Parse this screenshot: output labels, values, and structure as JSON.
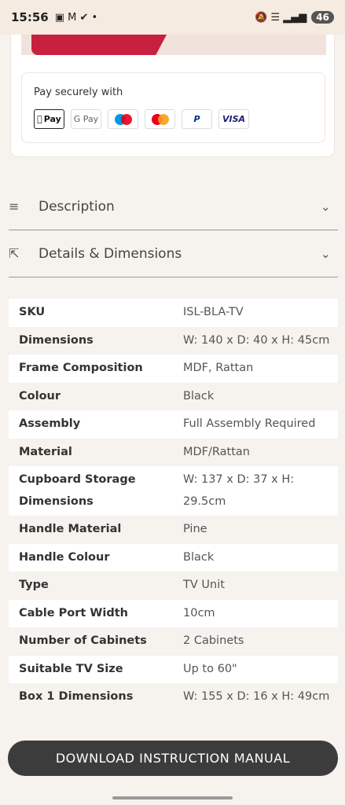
{
  "status": {
    "time": "15:56",
    "notif_icons": "▣ M ✔ •",
    "right_icons": "🔕 ☰ ▂▄▆",
    "battery": "46"
  },
  "payment": {
    "title": "Pay securely with",
    "methods": [
      "Pay",
      "G Pay",
      "maestro",
      "mastercard",
      "P",
      "VISA"
    ]
  },
  "accordion": {
    "description": "Description",
    "details": "Details & Dimensions"
  },
  "specs": [
    {
      "key": "SKU",
      "value": "ISL-BLA-TV"
    },
    {
      "key": "Dimensions",
      "value": "W: 140 x D: 40 x H: 45cm"
    },
    {
      "key": "Frame Composition",
      "value": "MDF, Rattan"
    },
    {
      "key": "Colour",
      "value": "Black"
    },
    {
      "key": "Assembly",
      "value": "Full Assembly Required"
    },
    {
      "key": "Material",
      "value": "MDF/Rattan"
    },
    {
      "key": "Cupboard Storage Dimensions",
      "value": "W: 137 x D: 37 x H: 29.5cm"
    },
    {
      "key": "Handle Material",
      "value": "Pine"
    },
    {
      "key": "Handle Colour",
      "value": "Black"
    },
    {
      "key": "Type",
      "value": "TV Unit"
    },
    {
      "key": "Cable Port Width",
      "value": "10cm"
    },
    {
      "key": "Number of Cabinets",
      "value": "2 Cabinets"
    },
    {
      "key": "Suitable TV Size",
      "value": "Up to 60\""
    },
    {
      "key": "Box 1 Dimensions",
      "value": "W: 155 x D: 16 x H: 49cm"
    }
  ],
  "download_label": "DOWNLOAD INSTRUCTION MANUAL",
  "colors": {
    "accent_red": "#c8203f",
    "button_dark": "#3c3c3c"
  }
}
